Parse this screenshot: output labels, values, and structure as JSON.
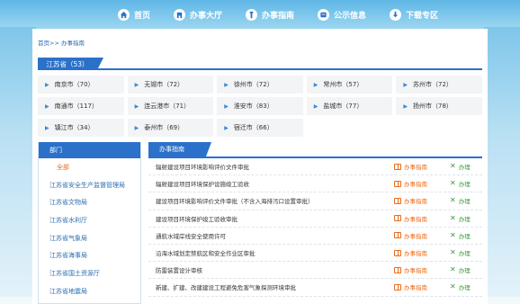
{
  "nav": {
    "items": [
      {
        "label": "首页",
        "icon": "home-icon"
      },
      {
        "label": "办事大厅",
        "icon": "building-icon"
      },
      {
        "label": "办事指南",
        "icon": "guide-icon"
      },
      {
        "label": "公示信息",
        "icon": "notice-icon"
      },
      {
        "label": "下载专区",
        "icon": "download-icon"
      }
    ]
  },
  "breadcrumb": {
    "home": "首页",
    "sep": ">>",
    "current": "办事指南"
  },
  "province": {
    "label": "江苏省（53）"
  },
  "cities": [
    {
      "label": "南京市（70）"
    },
    {
      "label": "无锡市（72）"
    },
    {
      "label": "徐州市（72）"
    },
    {
      "label": "常州市（57）"
    },
    {
      "label": "苏州市（72）"
    },
    {
      "label": "南通市（117）"
    },
    {
      "label": "连云港市（71）"
    },
    {
      "label": "淮安市（83）"
    },
    {
      "label": "盐城市（77）"
    },
    {
      "label": "扬州市（78）"
    },
    {
      "label": "镇江市（34）"
    },
    {
      "label": "泰州市（69）"
    },
    {
      "label": "宿迁市（66）"
    }
  ],
  "sidebar": {
    "header": "部门",
    "items": [
      {
        "label": "全部"
      },
      {
        "label": "江苏省安全生产监督管理局"
      },
      {
        "label": "江苏省文物局"
      },
      {
        "label": "江苏省水利厅"
      },
      {
        "label": "江苏省气象局"
      },
      {
        "label": "江苏省海事局"
      },
      {
        "label": "江苏省国土资源厅"
      },
      {
        "label": "江苏省地震局"
      }
    ]
  },
  "content": {
    "tab": "办事指南",
    "guide_label": "办事指南",
    "handle_label": "办理",
    "rows": [
      {
        "title": "辐射建设项目环境影响评价文件审批"
      },
      {
        "title": "辐射建设项目环境保护设施竣工验收"
      },
      {
        "title": "建设项目环境影响评价文件审批（不含入海排污口设置审批）"
      },
      {
        "title": "建设项目环境保护竣工验收审批"
      },
      {
        "title": "通航水域岸线安全使用许可"
      },
      {
        "title": "沿海水域划定禁航区和安全作业区审批"
      },
      {
        "title": "防雷装置设计审核"
      },
      {
        "title": "新建、扩建、改建建设工程避免危害气象探测环境审批"
      }
    ]
  },
  "colors": {
    "primary": "#2b71c9",
    "link": "#2a6db0",
    "accent": "#e86c1a",
    "success": "#3c9a3c"
  }
}
